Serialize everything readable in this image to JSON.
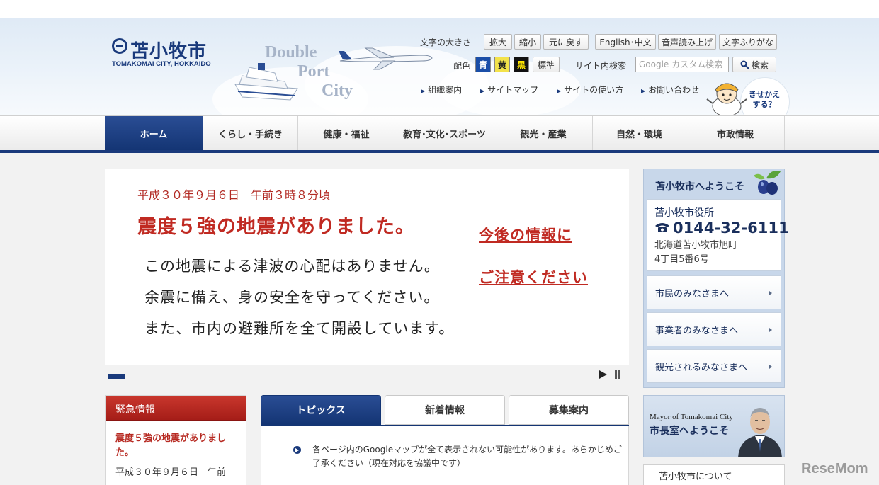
{
  "header": {
    "logo_jp": "苫小牧市",
    "logo_en": "TOMAKOMAI CITY, HOKKAIDO",
    "slogan": [
      "Double",
      "Port",
      "City"
    ],
    "font_size_label": "文字の大きさ",
    "font_buttons": [
      "拡大",
      "縮小",
      "元に戻す"
    ],
    "lang_button": "English･中文",
    "voice_button": "音声読み上げ",
    "furigana_button": "文字ふりがな",
    "color_label": "配色",
    "color_buttons": [
      "青",
      "黄",
      "黒"
    ],
    "color_standard": "標準",
    "search_label": "サイト内検索",
    "search_placeholder": "Google カスタム検索",
    "search_button": "検索",
    "links": [
      "組織案内",
      "サイトマップ",
      "サイトの使い方",
      "お問い合わせ"
    ],
    "kisekae": [
      "きせかえ",
      "する？"
    ]
  },
  "nav": [
    "ホーム",
    "くらし・手続き",
    "健康・福祉",
    "教育･文化･スポーツ",
    "観光・産業",
    "自然・環境",
    "市政情報"
  ],
  "slide": {
    "date": "平成３０年９月６日　午前３時８分頃",
    "headline": "震度５強の地震がありました。",
    "lines": [
      "この地震による津波の心配はありません。",
      "余震に備え、身の安全を守ってください。",
      "また、市内の避難所を全て開設しています。"
    ],
    "notice": [
      "今後の情報に",
      "ご注意ください"
    ]
  },
  "emergency": {
    "title": "緊急情報",
    "link": "震度５強の地震がありました。",
    "date": "平成３０年９月６日　午前"
  },
  "tabs": [
    "トピックス",
    "新着情報",
    "募集案内"
  ],
  "topics": [
    "各ページ内のGoogleマップが全て表示されない可能性があります。あらかじめご了承ください（現在対応を協議中です）"
  ],
  "side": {
    "welcome": "苫小牧市へようこそ",
    "cityhall": "苫小牧市役所",
    "phone": "0144-32-6111",
    "address": [
      "北海道苫小牧市旭町",
      "4丁目5番6号"
    ],
    "links": [
      "市民のみなさまへ",
      "事業者のみなさまへ",
      "観光されるみなさまへ"
    ]
  },
  "mayor": {
    "en": "Mayor of Tomakomai City",
    "jp": "市長室へようこそ"
  },
  "about": "苫小牧市について",
  "watermark": "ReseMom",
  "colors": {
    "navy": "#1a3a7c",
    "red": "#c02a22"
  }
}
